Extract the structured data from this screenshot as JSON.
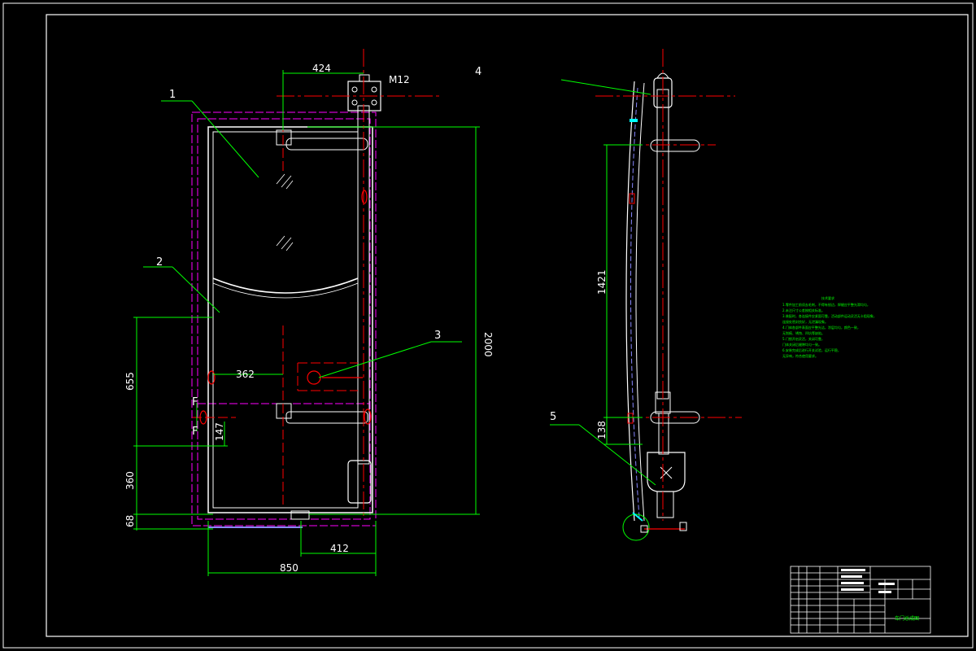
{
  "drawing": {
    "front_view": {
      "dimensions": {
        "hinge_offset": "424",
        "bolt": "M12",
        "height": "2000",
        "handle_to_edge": "362",
        "upper_span": "655",
        "small_offset": "147",
        "lower_span": "360",
        "bottom_gap": "68",
        "lock_width": "412",
        "width": "850"
      },
      "callouts": [
        "1",
        "2",
        "3",
        "4"
      ],
      "section_mark": "F"
    },
    "side_view": {
      "dimensions": {
        "upper_height": "1421",
        "lower_offset": "138"
      },
      "callouts": [
        "5"
      ]
    },
    "notes": {
      "title": "技术要求",
      "lines": [
        "1.零件加工前须去毛刺，不得有锐边，焊缝应平整光滑均匀，",
        "2.未注尺寸公差按相关标准。",
        "3.装配时，各连接件应紧固可靠，活动部件运动灵活无卡阻现象，",
        "连接处密封良好，无泄漏现象。",
        "4.门体各部件表面应平整光洁，涂层均匀，颜色一致，",
        "无划痕、锈蚀、凹坑等缺陷。",
        "5.门锁开启灵活，关闭可靠，",
        "门体关闭后缝隙均匀一致。",
        "6.安装完成后进行开关试验，运行平稳，",
        "无异响，符合使用要求。"
      ]
    },
    "title_block": {
      "drawing_title": "车门总成图"
    }
  }
}
